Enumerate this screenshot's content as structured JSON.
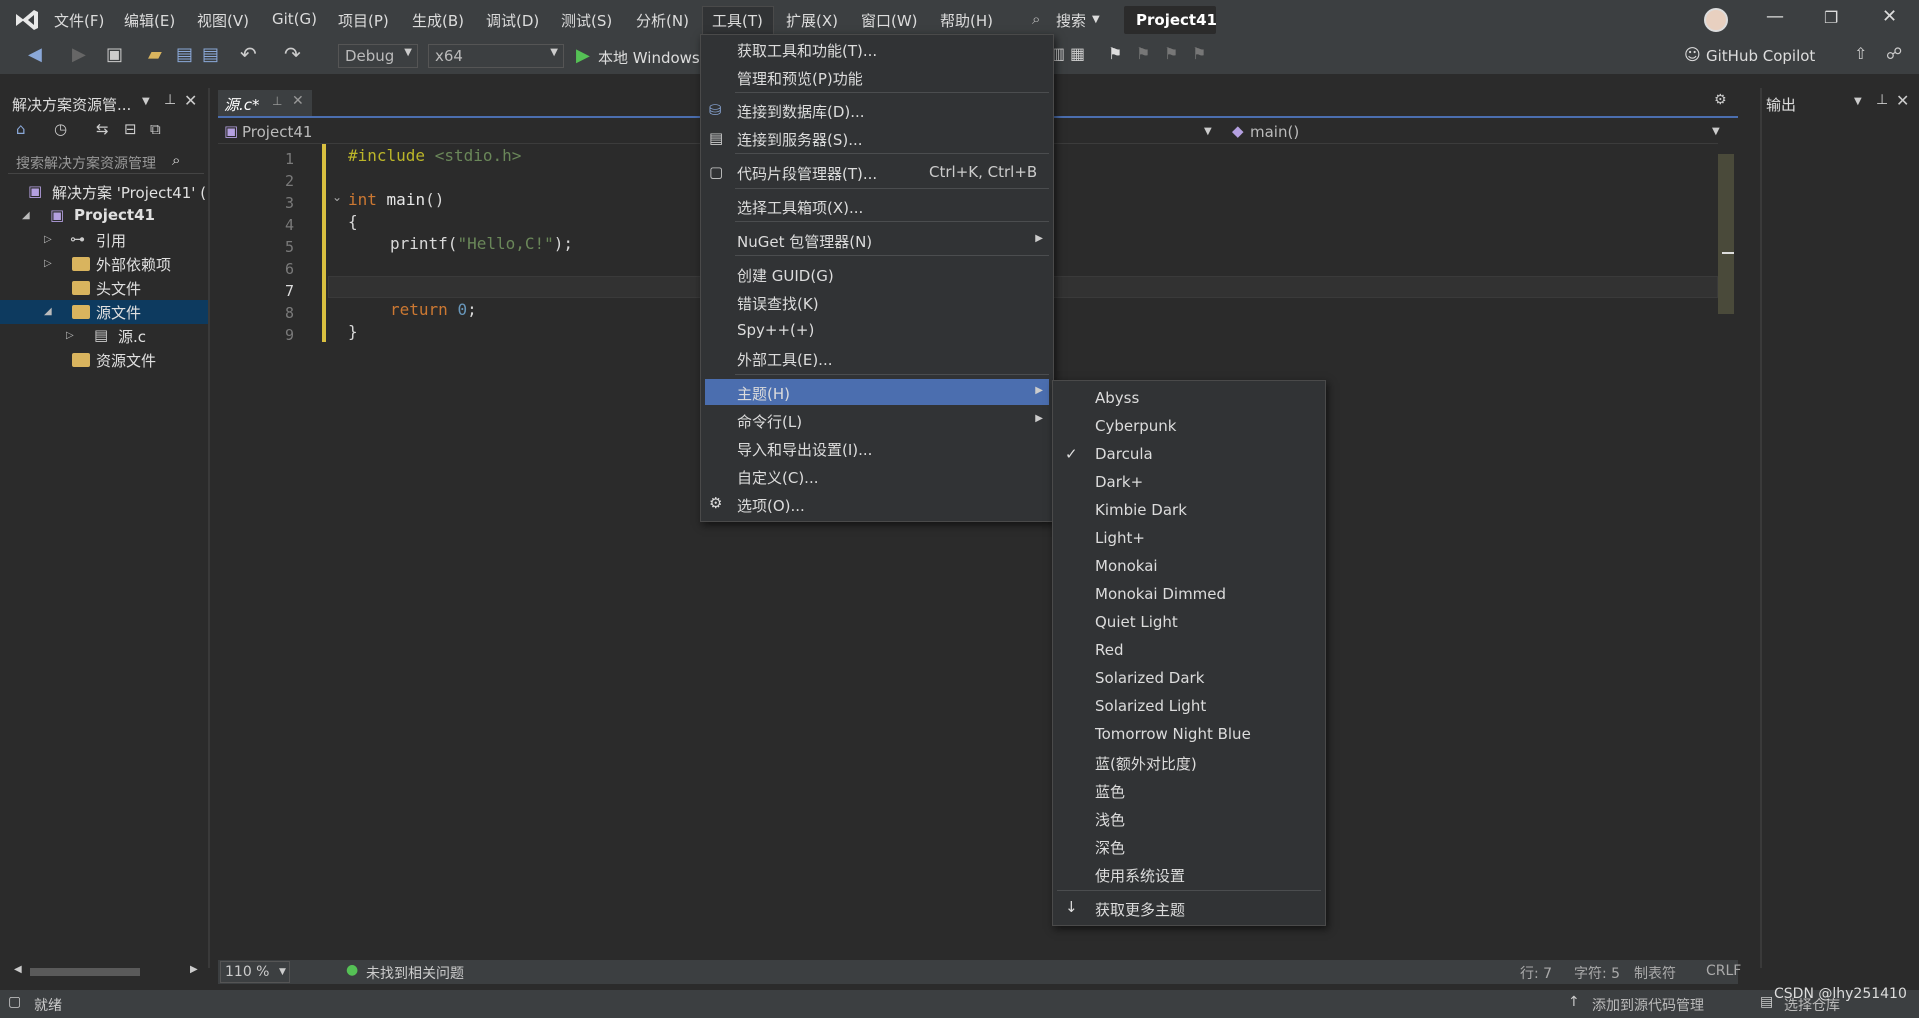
{
  "menubar": {
    "items": [
      "文件(F)",
      "编辑(E)",
      "视图(V)",
      "Git(G)",
      "项目(P)",
      "生成(B)",
      "调试(D)",
      "测试(S)",
      "分析(N)",
      "工具(T)",
      "扩展(X)",
      "窗口(W)",
      "帮助(H)"
    ],
    "search": "搜索",
    "project": "Project41"
  },
  "toolbar": {
    "config": "Debug",
    "platform": "x64",
    "run_label": "本地 Windows",
    "copilot": "GitHub Copilot"
  },
  "solution": {
    "title": "解决方案资源管...",
    "search_placeholder": "搜索解决方案资源管理",
    "items": [
      "解决方案 'Project41' (",
      "Project41",
      "引用",
      "外部依赖项",
      "头文件",
      "源文件",
      "源.c",
      "资源文件"
    ]
  },
  "editor": {
    "tab": "源.c*",
    "nav_project": "Project41",
    "nav_function": "main()",
    "lines": [
      "1",
      "2",
      "3",
      "4",
      "5",
      "6",
      "7",
      "8",
      "9"
    ]
  },
  "output": {
    "title": "输出"
  },
  "tools_menu": {
    "items": [
      "获取工具和功能(T)...",
      "管理和预览(P)功能",
      "连接到数据库(D)...",
      "连接到服务器(S)...",
      "代码片段管理器(T)...",
      "选择工具箱项(X)...",
      "NuGet 包管理器(N)",
      "创建 GUID(G)",
      "错误查找(K)",
      "Spy++(+)",
      "外部工具(E)...",
      "主题(H)",
      "命令行(L)",
      "导入和导出设置(I)...",
      "自定义(C)...",
      "选项(O)..."
    ],
    "snippet_shortcut": "Ctrl+K, Ctrl+B"
  },
  "theme_menu": {
    "items": [
      "Abyss",
      "Cyberpunk",
      "Darcula",
      "Dark+",
      "Kimbie Dark",
      "Light+",
      "Monokai",
      "Monokai Dimmed",
      "Quiet Light",
      "Red",
      "Solarized Dark",
      "Solarized Light",
      "Tomorrow Night Blue",
      "蓝(额外对比度)",
      "蓝色",
      "浅色",
      "深色",
      "使用系统设置"
    ],
    "more": "获取更多主题",
    "checked": "✓"
  },
  "editor_status": {
    "zoom": "110 %",
    "issues": "未找到相关问题",
    "line": "行: 7",
    "char": "字符: 5",
    "tab": "制表符",
    "eol": "CRLF"
  },
  "statusbar": {
    "ready": "就绪",
    "source_control": "添加到源代码管理",
    "repo": "选择仓库",
    "watermark": "CSDN @lhy251410"
  },
  "colors": {
    "accent": "#4b6eaf",
    "keyword": "#cc7832",
    "string": "#6a8759",
    "preproc": "#bbb529"
  }
}
